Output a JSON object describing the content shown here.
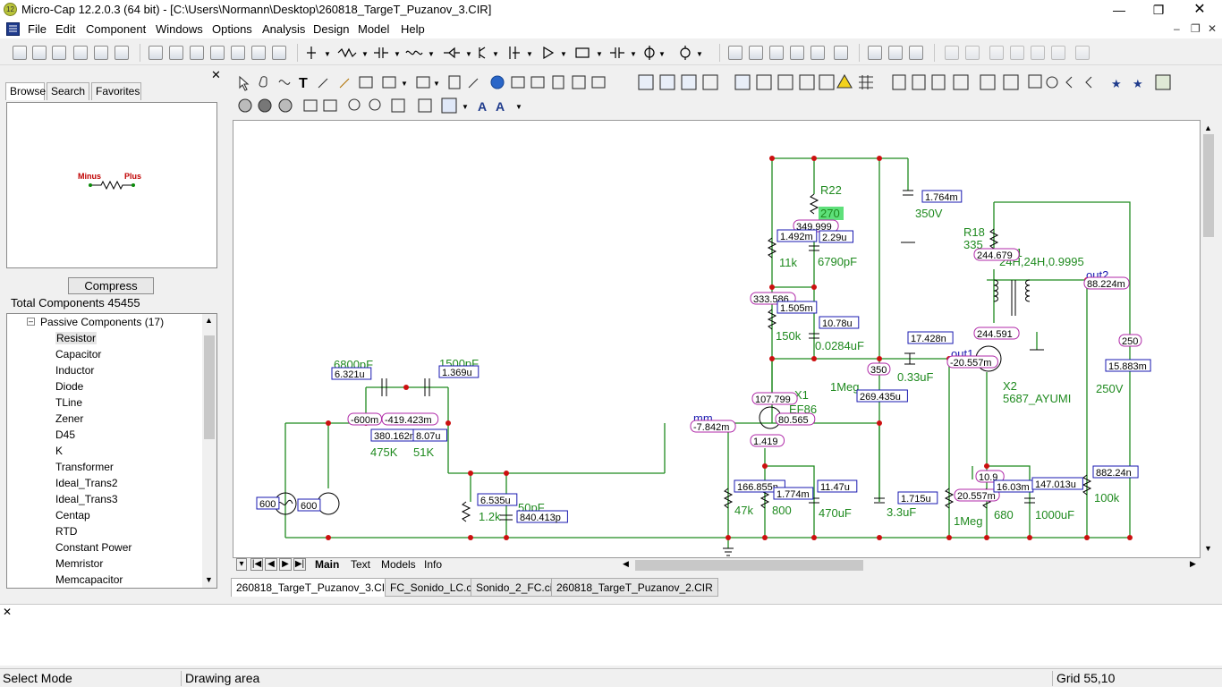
{
  "window": {
    "title": "Micro-Cap 12.2.0.3 (64 bit) - [C:\\Users\\Normann\\Desktop\\260818_TargeT_Puzanov_3.CIR]",
    "icon_text": "12"
  },
  "menu": [
    "File",
    "Edit",
    "Component",
    "Windows",
    "Options",
    "Analysis",
    "Design",
    "Model",
    "Help"
  ],
  "left_panel": {
    "tabs": [
      "Browse",
      "Search",
      "Favorites"
    ],
    "preview_labels": {
      "minus": "Minus",
      "plus": "Plus"
    },
    "compress_label": "Compress",
    "total_components": "Total Components 45455",
    "tree_group": "Passive Components (17)",
    "tree_items": [
      "Resistor",
      "Capacitor",
      "Inductor",
      "Diode",
      "TLine",
      "Zener",
      "D45",
      "K",
      "Transformer",
      "Ideal_Trans2",
      "Ideal_Trans3",
      "Centap",
      "RTD",
      "Constant Power",
      "Memristor",
      "Memcapacitor"
    ]
  },
  "sheet_tabs": [
    "Main",
    "Text",
    "Models",
    "Info"
  ],
  "doc_tabs": [
    "260818_TargeT_Puzanov_3.CIR",
    "FC_Sonido_LC.cir",
    "Sonido_2_FC.cir",
    "260818_TargeT_Puzanov_2.CIR"
  ],
  "status": {
    "mode": "Select Mode",
    "area": "Drawing area",
    "grid": "Grid 55,10"
  },
  "schematic": {
    "component_labels": [
      "R22",
      "270",
      "350V",
      "R18",
      "335",
      "K1",
      "24H,24H,0.9995",
      "out2",
      "11k",
      "6790pF",
      "150k",
      "0.0284uF",
      "0.33uF",
      "out1",
      "250V",
      "1Meg",
      "X1",
      "EF86",
      "X2",
      "5687_AYUMI",
      "6800pF",
      "1500pF",
      "475K",
      "51K",
      "mm",
      "50pF",
      "1.2k",
      "47k",
      "800",
      "470uF",
      "3.3uF",
      "1Meg",
      "680",
      "1000uF",
      "100k"
    ],
    "voltage_tags": [
      "349.999",
      "244.679",
      "333.586",
      "244.591",
      "350",
      "107.799",
      "80.565",
      "-7.842m",
      "1.419",
      "-600m",
      "-419.423m",
      "-20.557m",
      "10.9",
      "250",
      "88.224m",
      "20.557m"
    ],
    "current_tags": [
      "1.764m",
      "1.492m",
      "2.29u",
      "1.505m",
      "10.78u",
      "17.428n",
      "269.435u",
      "6.321u",
      "1.369u",
      "380.162n",
      "8.07u",
      "6.535u",
      "840.413p",
      "166.855n",
      "1.774m",
      "11.47u",
      "1.715u",
      "16.03m",
      "147.013u",
      "882.24n",
      "15.883m",
      "600",
      "600"
    ]
  }
}
